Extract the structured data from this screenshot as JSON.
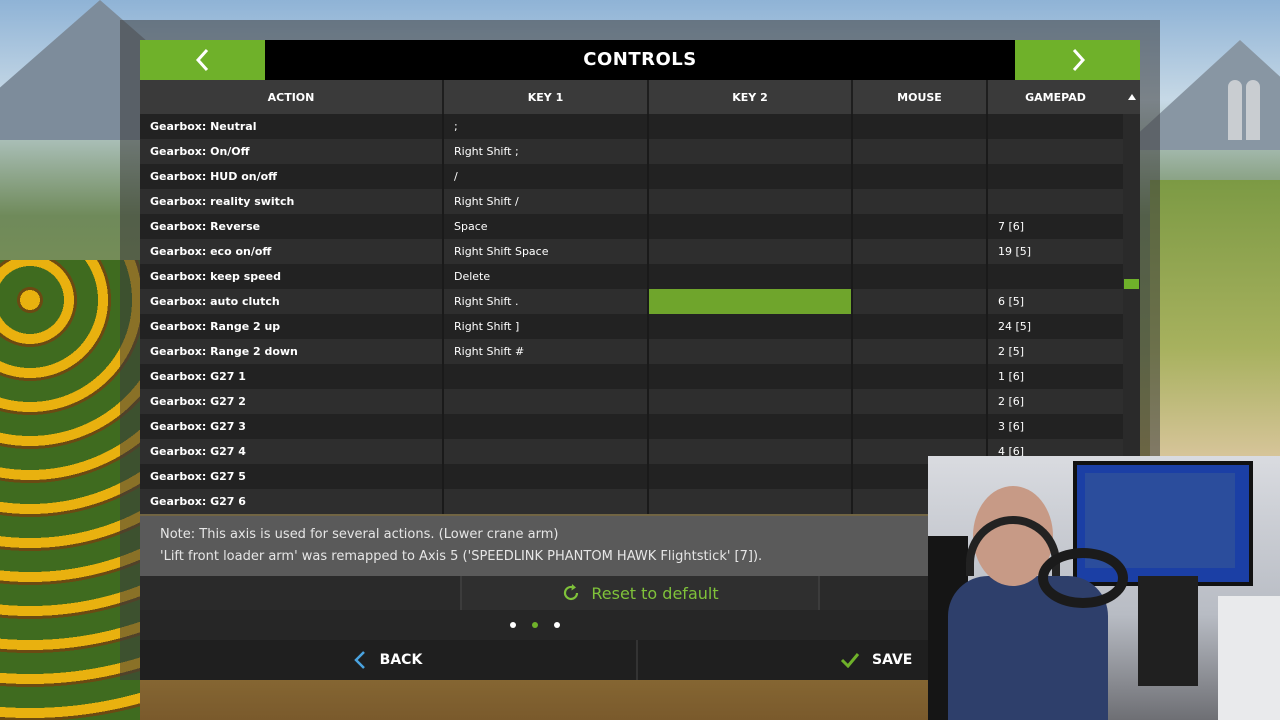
{
  "header": {
    "title": "CONTROLS",
    "prev_icon": "chevron-left-icon",
    "next_icon": "chevron-right-icon"
  },
  "columns": [
    "ACTION",
    "KEY 1",
    "KEY 2",
    "MOUSE",
    "GAMEPAD"
  ],
  "rows": [
    {
      "action": "Gearbox: Neutral",
      "key1": ";",
      "key2": "",
      "mouse": "",
      "gamepad": ""
    },
    {
      "action": "Gearbox: On/Off",
      "key1": "Right Shift ;",
      "key2": "",
      "mouse": "",
      "gamepad": ""
    },
    {
      "action": "Gearbox: HUD on/off",
      "key1": "/",
      "key2": "",
      "mouse": "",
      "gamepad": ""
    },
    {
      "action": "Gearbox: reality switch",
      "key1": "Right Shift /",
      "key2": "",
      "mouse": "",
      "gamepad": ""
    },
    {
      "action": "Gearbox: Reverse",
      "key1": "Space",
      "key2": "",
      "mouse": "",
      "gamepad": "7 [6]"
    },
    {
      "action": "Gearbox: eco on/off",
      "key1": "Right Shift Space",
      "key2": "",
      "mouse": "",
      "gamepad": "19 [5]"
    },
    {
      "action": "Gearbox: keep speed",
      "key1": "Delete",
      "key2": "",
      "mouse": "",
      "gamepad": ""
    },
    {
      "action": "Gearbox: auto clutch",
      "key1": "Right Shift .",
      "key2": "",
      "mouse": "",
      "gamepad": "6 [5]"
    },
    {
      "action": "Gearbox: Range 2 up",
      "key1": "Right Shift ]",
      "key2": "",
      "mouse": "",
      "gamepad": "24 [5]"
    },
    {
      "action": "Gearbox: Range 2 down",
      "key1": "Right Shift #",
      "key2": "",
      "mouse": "",
      "gamepad": "2 [5]"
    },
    {
      "action": "Gearbox: G27 1",
      "key1": "",
      "key2": "",
      "mouse": "",
      "gamepad": "1 [6]"
    },
    {
      "action": "Gearbox: G27 2",
      "key1": "",
      "key2": "",
      "mouse": "",
      "gamepad": "2 [6]"
    },
    {
      "action": "Gearbox: G27 3",
      "key1": "",
      "key2": "",
      "mouse": "",
      "gamepad": "3 [6]"
    },
    {
      "action": "Gearbox: G27 4",
      "key1": "",
      "key2": "",
      "mouse": "",
      "gamepad": "4 [6]"
    },
    {
      "action": "Gearbox: G27 5",
      "key1": "",
      "key2": "",
      "mouse": "",
      "gamepad": ""
    },
    {
      "action": "Gearbox: G27 6",
      "key1": "",
      "key2": "",
      "mouse": "",
      "gamepad": ""
    }
  ],
  "selected": {
    "row": 7,
    "column": "key2"
  },
  "scroll": {
    "position_fraction": 0.42
  },
  "note": {
    "line1": "Note: This axis is used for several actions. (Lower crane arm)",
    "line2": "'Lift front loader arm' was remapped to Axis 5 ('SPEEDLINK PHANTOM HAWK Flightstick' [7])."
  },
  "reset": {
    "label": "Reset to default",
    "icon": "refresh-icon"
  },
  "pager": {
    "count": 3,
    "active": 1
  },
  "footer": {
    "back_label": "BACK",
    "save_label": "SAVE",
    "back_icon": "chevron-left-icon",
    "save_icon": "checkmark-icon"
  },
  "colors": {
    "accent": "#6fb12a",
    "header_bg": "#000000",
    "row_odd": "#222222",
    "row_even": "#2e2e2e",
    "selected": "#6fa52c"
  }
}
